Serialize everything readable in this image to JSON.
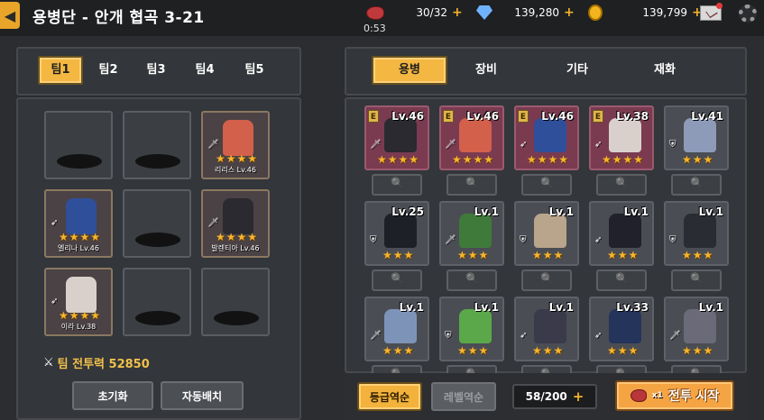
{
  "header": {
    "title": "용병단  -  안개 협곡 3-21",
    "timer": "0:53",
    "resources": [
      {
        "name": "stamina",
        "icon": "meat-icon",
        "value": "30/32",
        "color": "#c0393d"
      },
      {
        "name": "gems",
        "icon": "diamond-icon",
        "value": "139,280",
        "color": "#6fb3ff"
      },
      {
        "name": "gold",
        "icon": "coin-icon",
        "value": "139,799",
        "color": "#f2b51d"
      }
    ]
  },
  "team_panel": {
    "tabs": [
      "팀1",
      "팀2",
      "팀3",
      "팀4",
      "팀5"
    ],
    "active_tab": 0,
    "slots": [
      {
        "name": "",
        "stars": 0
      },
      {
        "name": "",
        "stars": 0
      },
      {
        "name": "리리스 Lv.46",
        "stars": 4,
        "role": "sword",
        "color": "#d2604a"
      },
      {
        "name": "엘리나 Lv.46",
        "stars": 4,
        "role": "bow",
        "color": "#2f4f9a"
      },
      {
        "name": "",
        "stars": 0
      },
      {
        "name": "발렌티아 Lv.46",
        "stars": 4,
        "role": "sword",
        "color": "#2a2a30"
      },
      {
        "name": "이라 Lv.38",
        "stars": 4,
        "role": "bow",
        "color": "#d9d0cc"
      },
      {
        "name": "",
        "stars": 0
      },
      {
        "name": "",
        "stars": 0
      }
    ],
    "power_label": "팀 전투력 52850",
    "reset_button": "초기화",
    "auto_button": "자동배치"
  },
  "merc_panel": {
    "tabs": [
      "용병",
      "장비",
      "기타",
      "재화"
    ],
    "active_tab": 0,
    "cards": [
      {
        "lv": "Lv.46",
        "stars": 4,
        "epic": true,
        "grade": "E",
        "role": "sword",
        "color": "#2a2a30"
      },
      {
        "lv": "Lv.46",
        "stars": 4,
        "epic": true,
        "grade": "E",
        "role": "sword",
        "color": "#d2604a"
      },
      {
        "lv": "Lv.46",
        "stars": 4,
        "epic": true,
        "grade": "E",
        "role": "bow",
        "color": "#2f4f9a"
      },
      {
        "lv": "Lv.38",
        "stars": 4,
        "epic": true,
        "grade": "E",
        "role": "bow",
        "color": "#d9d0cc"
      },
      {
        "lv": "Lv.41",
        "stars": 3,
        "epic": false,
        "grade": "",
        "role": "shield",
        "color": "#8e9bb8"
      },
      {
        "lv": "Lv.25",
        "stars": 3,
        "epic": false,
        "grade": "",
        "role": "shield",
        "color": "#1e2028"
      },
      {
        "lv": "Lv.1",
        "stars": 3,
        "epic": false,
        "grade": "",
        "role": "sword",
        "color": "#3f7a3a"
      },
      {
        "lv": "Lv.1",
        "stars": 3,
        "epic": false,
        "grade": "",
        "role": "shield",
        "color": "#b9a58c"
      },
      {
        "lv": "Lv.1",
        "stars": 3,
        "epic": false,
        "grade": "",
        "role": "bow",
        "color": "#20212a"
      },
      {
        "lv": "Lv.1",
        "stars": 3,
        "epic": false,
        "grade": "",
        "role": "shield",
        "color": "#2a2c33"
      },
      {
        "lv": "Lv.1",
        "stars": 3,
        "epic": false,
        "grade": "",
        "role": "sword",
        "color": "#7e93b8"
      },
      {
        "lv": "Lv.1",
        "stars": 3,
        "epic": false,
        "grade": "",
        "role": "shield",
        "color": "#5aa84a"
      },
      {
        "lv": "Lv.1",
        "stars": 3,
        "epic": false,
        "grade": "",
        "role": "bow",
        "color": "#3a3a4a"
      },
      {
        "lv": "Lv.33",
        "stars": 3,
        "epic": false,
        "grade": "",
        "role": "bow",
        "color": "#24345a"
      },
      {
        "lv": "Lv.1",
        "stars": 3,
        "epic": false,
        "grade": "",
        "role": "sword",
        "color": "#6a6a78"
      }
    ],
    "sort_grade": "등급역순",
    "sort_level": "레벨역순",
    "count": "58/200",
    "start_multiplier": "x1",
    "start_label": "전투 시작"
  }
}
